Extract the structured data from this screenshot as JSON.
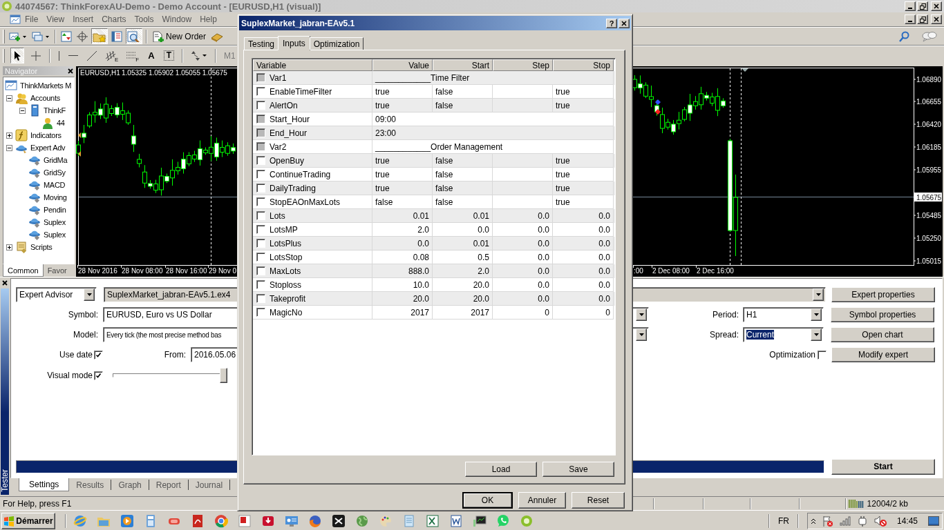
{
  "window": {
    "title": "44074567: ThinkForexAU-Demo - Demo Account - [EURUSD,H1 (visual)]",
    "menu": [
      "File",
      "View",
      "Insert",
      "Charts",
      "Tools",
      "Window",
      "Help"
    ]
  },
  "toolbar": {
    "items": [
      {
        "kind": "newchart",
        "on": false
      },
      {
        "kind": "windows",
        "on": false
      },
      {
        "kind": "arrows",
        "on": false
      },
      {
        "kind": "crosshair",
        "on": false
      },
      {
        "kind": "folderstar",
        "on": true
      },
      {
        "kind": "panel",
        "on": false
      },
      {
        "kind": "magnifier",
        "on": true
      },
      {
        "kind": "order",
        "label": "New Order",
        "on": false
      },
      {
        "kind": "book",
        "on": false
      }
    ]
  },
  "drawing_toolbar": {
    "items": [
      {
        "kind": "cursor",
        "on": true
      },
      {
        "kind": "cross",
        "on": false
      },
      {
        "kind": "vline",
        "on": false
      },
      {
        "kind": "hline",
        "on": false
      },
      {
        "kind": "trend",
        "on": false
      },
      {
        "kind": "channel",
        "label": "E",
        "on": false
      },
      {
        "kind": "fibo",
        "label": "F",
        "on": false
      },
      {
        "kind": "text",
        "label": "A",
        "on": false
      },
      {
        "kind": "textbox",
        "label": "T",
        "on": false
      },
      {
        "kind": "arrowsmenu",
        "on": false
      }
    ],
    "timeframe": {
      "label": "M1",
      "disabled": true
    }
  },
  "navigator": {
    "title": "Navigator",
    "tree": [
      {
        "kind": "terminal",
        "label": "ThinkMarkets M",
        "children": [
          {
            "kind": "accounts",
            "label": "Accounts",
            "expanded": true,
            "children": [
              {
                "kind": "server",
                "label": "ThinkF",
                "expanded": true,
                "children": [
                  {
                    "kind": "user",
                    "label": "44"
                  }
                ]
              }
            ]
          },
          {
            "kind": "indicators",
            "label": "Indicators",
            "expanded": false
          },
          {
            "kind": "experts",
            "label": "Expert Adv",
            "expanded": true,
            "children": [
              {
                "kind": "expert",
                "label": "GridMa"
              },
              {
                "kind": "expert",
                "label": "GridSy"
              },
              {
                "kind": "expert",
                "label": "MACD"
              },
              {
                "kind": "expert",
                "label": "Moving"
              },
              {
                "kind": "expert",
                "label": "Pendin"
              },
              {
                "kind": "expert",
                "label": "Suplex"
              },
              {
                "kind": "expert",
                "label": "Suplex"
              }
            ]
          },
          {
            "kind": "scripts",
            "label": "Scripts",
            "expanded": false
          }
        ]
      }
    ],
    "tabs": [
      {
        "label": "Common",
        "selected": true
      },
      {
        "label": "Favor",
        "selected": false
      }
    ]
  },
  "chart": {
    "symbol": "EURUSD,H1",
    "ohlc": "1.05325 1.05902 1.05055 1.05675",
    "price_labels": [
      "1.06890",
      "1.06655",
      "1.06420",
      "1.06185",
      "1.05955",
      "1.05485",
      "1.05250",
      "1.05015"
    ],
    "current_price": "1.05675",
    "time_labels": [
      "28 Nov 2016",
      "28 Nov 08:00",
      "28 Nov 16:00",
      "29 Nov 0",
      ":00",
      "2 Dec 08:00",
      "2 Dec 16:00"
    ]
  },
  "tester": {
    "side_label": "Tester",
    "program_type": "Expert Advisor",
    "expert": "SuplexMarket_jabran-EAv5.1.ex4",
    "symbol": {
      "label": "Symbol:",
      "value": "EURUSD, Euro vs US Dollar"
    },
    "model": {
      "label": "Model:",
      "value": "Every tick (the most precise method bas"
    },
    "period": {
      "label": "Period:",
      "value": "H1"
    },
    "spread": {
      "label": "Spread:",
      "value": "Current",
      "selected": true
    },
    "use_date": {
      "label": "Use date",
      "checked": true
    },
    "from": {
      "label": "From:",
      "value": "2016.05.06"
    },
    "optimization": {
      "label": "Optimization",
      "checked": false
    },
    "visual_mode": {
      "label": "Visual mode",
      "checked": true,
      "level": 1
    },
    "progress": {
      "level": 1
    },
    "buttons": [
      "Expert properties",
      "Symbol properties",
      "Open chart",
      "Modify expert"
    ],
    "start": "Start",
    "tabs": [
      {
        "label": "Settings",
        "selected": true
      },
      {
        "label": "Results",
        "selected": false
      },
      {
        "label": "Graph",
        "selected": false
      },
      {
        "label": "Report",
        "selected": false
      },
      {
        "label": "Journal",
        "selected": false
      }
    ]
  },
  "status_bar": {
    "help": "For Help, press F1",
    "memory": "12004/2 kb"
  },
  "taskbar": {
    "start": "Démarrer",
    "language": "FR",
    "clock": "14:45"
  },
  "dialog": {
    "title": "SuplexMarket_jabran-EAv5.1",
    "help_button": "?",
    "tabs": [
      {
        "label": "Testing",
        "selected": false
      },
      {
        "label": "Inputs",
        "selected": true
      },
      {
        "label": "Optimization",
        "selected": false
      }
    ],
    "columns": [
      "Variable",
      "Value",
      "Start",
      "Step",
      "Stop"
    ],
    "rows": [
      {
        "kind": "text",
        "name": "Var1",
        "checked": false,
        "disabled": true,
        "value": "____________Time Filter"
      },
      {
        "kind": "bool",
        "name": "EnableTimeFilter",
        "checked": false,
        "disabled": false,
        "value": "true",
        "start": "false",
        "stop": "true"
      },
      {
        "kind": "bool",
        "name": "AlertOn",
        "checked": false,
        "disabled": false,
        "value": "true",
        "start": "false",
        "stop": "true"
      },
      {
        "kind": "text",
        "name": "Start_Hour",
        "checked": false,
        "disabled": true,
        "value": "09:00"
      },
      {
        "kind": "text",
        "name": "End_Hour",
        "checked": false,
        "disabled": true,
        "value": "23:00"
      },
      {
        "kind": "text",
        "name": "Var2",
        "checked": false,
        "disabled": true,
        "value": "____________Order Management"
      },
      {
        "kind": "bool",
        "name": "OpenBuy",
        "checked": false,
        "disabled": false,
        "value": "true",
        "start": "false",
        "stop": "true"
      },
      {
        "kind": "bool",
        "name": "ContinueTrading",
        "checked": false,
        "disabled": false,
        "value": "true",
        "start": "false",
        "stop": "true"
      },
      {
        "kind": "bool",
        "name": "DailyTrading",
        "checked": false,
        "disabled": false,
        "value": "true",
        "start": "false",
        "stop": "true"
      },
      {
        "kind": "bool",
        "name": "StopEAOnMaxLots",
        "checked": false,
        "disabled": false,
        "value": "false",
        "start": "false",
        "stop": "true"
      },
      {
        "kind": "number",
        "name": "Lots",
        "checked": false,
        "disabled": false,
        "value": "0.01",
        "start": "0.01",
        "step": "0.0",
        "stop": "0.0"
      },
      {
        "kind": "number",
        "name": "LotsMP",
        "checked": false,
        "disabled": false,
        "value": "2.0",
        "start": "0.0",
        "step": "0.0",
        "stop": "0.0"
      },
      {
        "kind": "number",
        "name": "LotsPlus",
        "checked": false,
        "disabled": false,
        "value": "0.0",
        "start": "0.01",
        "step": "0.0",
        "stop": "0.0"
      },
      {
        "kind": "number",
        "name": "LotsStop",
        "checked": false,
        "disabled": false,
        "value": "0.08",
        "start": "0.5",
        "step": "0.0",
        "stop": "0.0"
      },
      {
        "kind": "number",
        "name": "MaxLots",
        "checked": false,
        "disabled": false,
        "value": "888.0",
        "start": "2.0",
        "step": "0.0",
        "stop": "0.0"
      },
      {
        "kind": "number",
        "name": "Stoploss",
        "checked": false,
        "disabled": false,
        "value": "10.0",
        "start": "20.0",
        "step": "0.0",
        "stop": "0.0"
      },
      {
        "kind": "number",
        "name": "Takeprofit",
        "checked": false,
        "disabled": false,
        "value": "20.0",
        "start": "20.0",
        "step": "0.0",
        "stop": "0.0"
      },
      {
        "kind": "number",
        "name": "MagicNo",
        "checked": false,
        "disabled": false,
        "value": "2017",
        "start": "2017",
        "step": "0",
        "stop": "0"
      }
    ],
    "buttons": [
      "Load",
      "Save"
    ],
    "footer_buttons": [
      {
        "label": "OK",
        "default": true
      },
      {
        "label": "Annuler",
        "default": false
      },
      {
        "label": "Reset",
        "default": false
      }
    ]
  }
}
